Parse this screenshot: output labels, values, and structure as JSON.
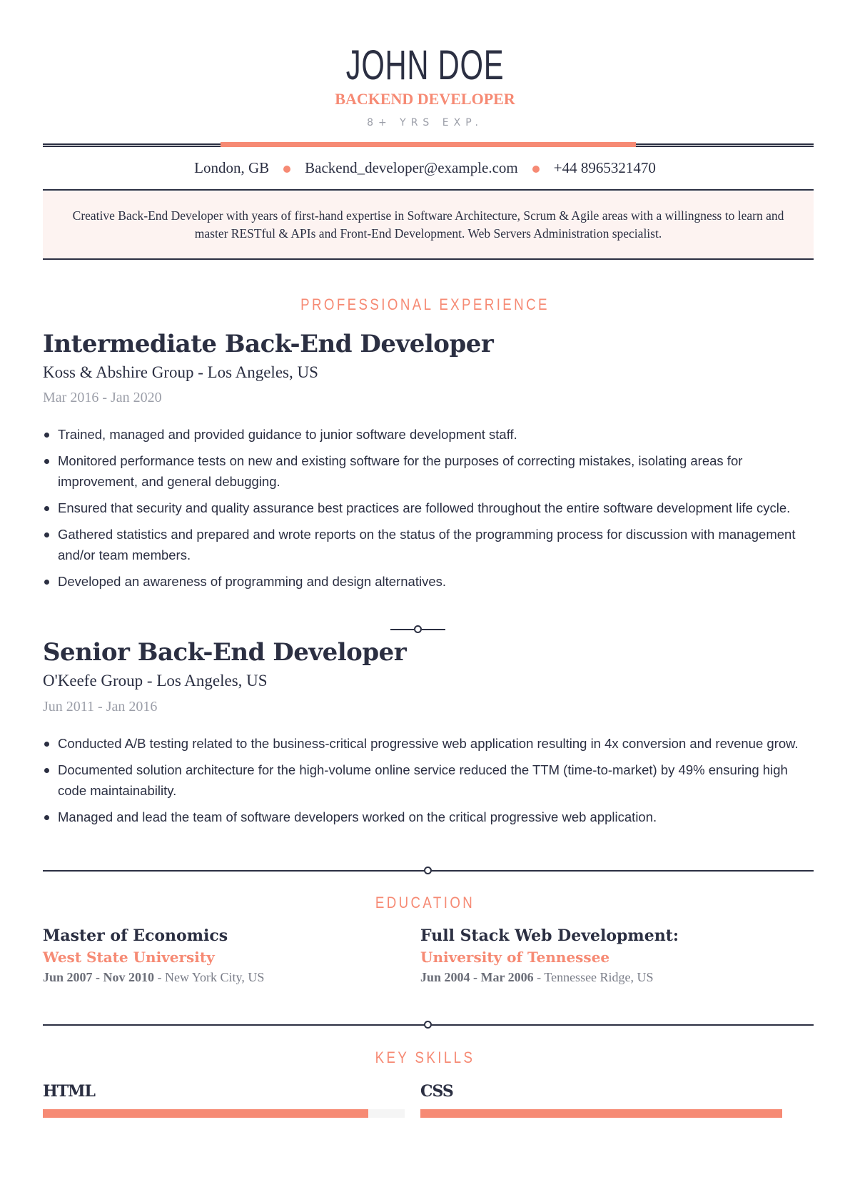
{
  "header": {
    "name": "JOHN DOE",
    "title": "BACKEND DEVELOPER",
    "experience": "8+ YRS EXP."
  },
  "contact": {
    "location": "London, GB",
    "email": "Backend_developer@example.com",
    "phone": "+44 8965321470"
  },
  "summary": "Creative Back-End Developer with years of first-hand expertise in Software Architecture, Scrum & Agile areas with a willingness to learn and master RESTful & APIs and Front-End Development. Web Servers Administration specialist.",
  "experience": {
    "heading": "PROFESSIONAL EXPERIENCE",
    "jobs": [
      {
        "title": "Intermediate Back-End Developer",
        "company": "Koss & Abshire Group - Los Angeles, US",
        "dates": "Mar 2016 - Jan 2020",
        "bullets": [
          "Trained, managed and provided guidance to junior software development staff.",
          "Monitored performance tests on new and existing software for the purposes of correcting mistakes, isolating areas for improvement, and general debugging.",
          "Ensured that security and quality assurance best practices are followed throughout the entire software development life cycle.",
          "Gathered statistics and prepared and wrote reports on the status of the programming process for discussion with management and/or team members.",
          "Developed an awareness of programming and design alternatives."
        ]
      },
      {
        "title": "Senior Back-End Developer",
        "company": "O'Keefe Group - Los Angeles, US",
        "dates": "Jun 2011 - Jan 2016",
        "bullets": [
          "Conducted A/B testing related to the business-critical progressive web application resulting in 4x conversion and revenue grow.",
          "Documented solution architecture for the high-volume online service reduced the TTM (time-to-market) by 49% ensuring high code maintainability.",
          "Managed and lead the team of software developers worked on the critical progressive web application."
        ]
      }
    ]
  },
  "education": {
    "heading": "EDUCATION",
    "items": [
      {
        "degree": "Master of Economics",
        "school": "West State University",
        "dates": "Jun 2007 - Nov 2010",
        "location": " - New York City, US"
      },
      {
        "degree": "Full Stack Web Development:",
        "school": "University of Tennessee",
        "dates": "Jun 2004 - Mar 2006",
        "location": " - Tennessee Ridge, US"
      }
    ]
  },
  "skills": {
    "heading": "KEY SKILLS",
    "items": [
      {
        "name": "HTML",
        "level_percent": 90
      },
      {
        "name": "CSS",
        "level_percent": 100
      }
    ]
  },
  "colors": {
    "accent": "#f68a74",
    "primary": "#2b2f42",
    "muted": "#9b9ea8",
    "summary_bg": "#fdf3f1"
  }
}
